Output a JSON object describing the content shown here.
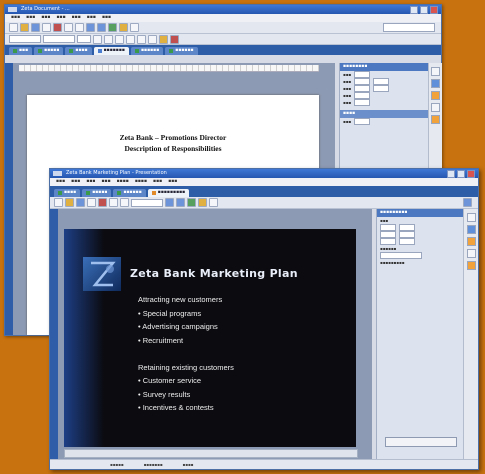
{
  "colors": {
    "background": "#c8720f",
    "titlebar": "#2f64c0",
    "tab_strip": "#2e5da8",
    "slide_background": "#0b0b10",
    "slide_gradient": "#1d3f86"
  },
  "document_window": {
    "title_text": "Zeta Document - ...",
    "document": {
      "heading_line1": "Zeta Bank – Promotions Director",
      "heading_line2": "Description of Responsibilities"
    }
  },
  "presentation_window": {
    "title_text": "Zeta Bank Marketing Plan - Presentation",
    "slide": {
      "title": "Zeta Bank Marketing Plan",
      "logo_icon": "zeta-bank-logo",
      "bullets": [
        "Attracting new customers",
        "• Special programs",
        "• Advertising campaigns",
        "• Recruitment",
        "",
        "Retaining existing customers",
        "• Customer service",
        "• Survey results",
        "• Incentives & contests"
      ]
    }
  }
}
